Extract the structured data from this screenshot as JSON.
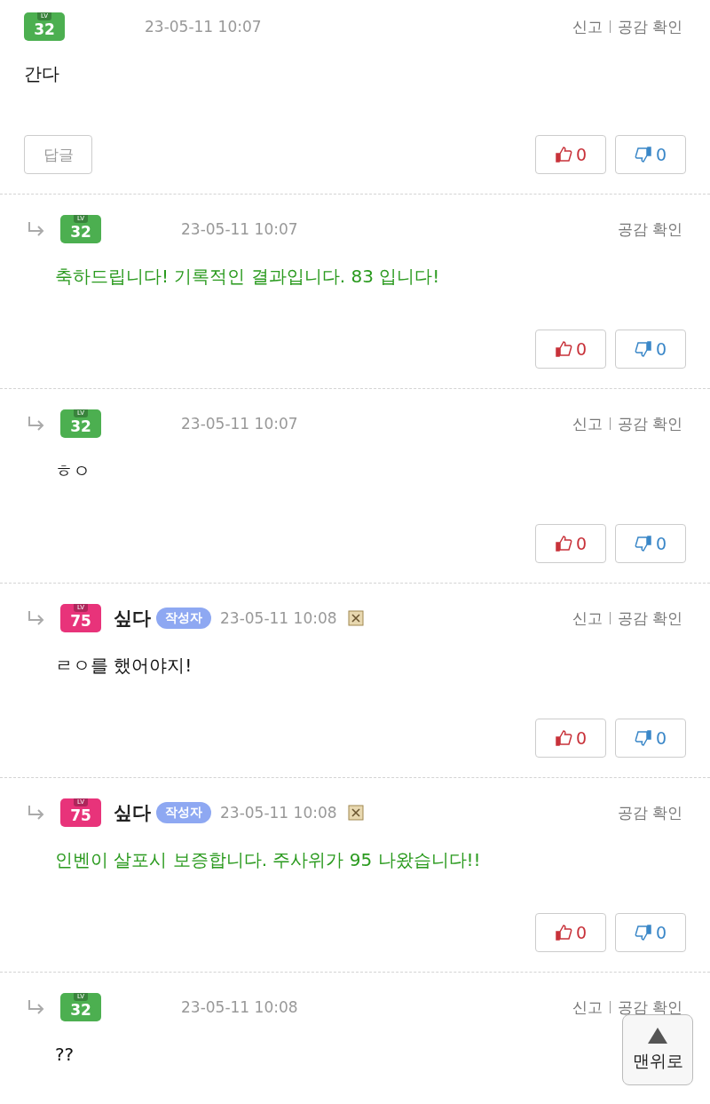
{
  "comments": [
    {
      "reply": false,
      "badge": {
        "label": "LV",
        "level": "32",
        "color": "#4caf50"
      },
      "date": "23-05-11 10:07",
      "deletable": false,
      "actions": [
        "신고",
        "공감 확인"
      ],
      "text": "간다",
      "kind": "normal",
      "reply_button": "답글",
      "likes": "0",
      "dislikes": "0"
    },
    {
      "reply": true,
      "badge": {
        "label": "LV",
        "level": "32",
        "color": "#4caf50"
      },
      "date": "23-05-11 10:07",
      "deletable": false,
      "actions": [
        "공감 확인"
      ],
      "text": "축하드립니다! 기록적인 결과입니다. 83 입니다!",
      "kind": "highlight",
      "likes": "0",
      "dislikes": "0"
    },
    {
      "reply": true,
      "badge": {
        "label": "LV",
        "level": "32",
        "color": "#4caf50"
      },
      "date": "23-05-11 10:07",
      "deletable": false,
      "actions": [
        "신고",
        "공감 확인"
      ],
      "text": "ㅎㅇ",
      "kind": "normal",
      "likes": "0",
      "dislikes": "0"
    },
    {
      "reply": true,
      "badge": {
        "label": "LV",
        "level": "75",
        "color": "#e8337a"
      },
      "author": "싶다",
      "author_tag": "작성자",
      "date": "23-05-11 10:08",
      "deletable": true,
      "actions": [
        "신고",
        "공감 확인"
      ],
      "text": "ㄹㅇ를 했어야지!",
      "kind": "normal",
      "likes": "0",
      "dislikes": "0"
    },
    {
      "reply": true,
      "badge": {
        "label": "LV",
        "level": "75",
        "color": "#e8337a"
      },
      "author": "싶다",
      "author_tag": "작성자",
      "date": "23-05-11 10:08",
      "deletable": true,
      "actions": [
        "공감 확인"
      ],
      "text": "인벤이 살포시 보증합니다. 주사위가 95 나왔습니다!!",
      "kind": "highlight",
      "likes": "0",
      "dislikes": "0"
    },
    {
      "reply": true,
      "badge": {
        "label": "LV",
        "level": "32",
        "color": "#4caf50"
      },
      "date": "23-05-11 10:08",
      "deletable": false,
      "actions": [
        "신고",
        "공감 확인"
      ],
      "text": "??",
      "kind": "normal"
    }
  ],
  "scroll_top": {
    "label": "맨위로"
  }
}
